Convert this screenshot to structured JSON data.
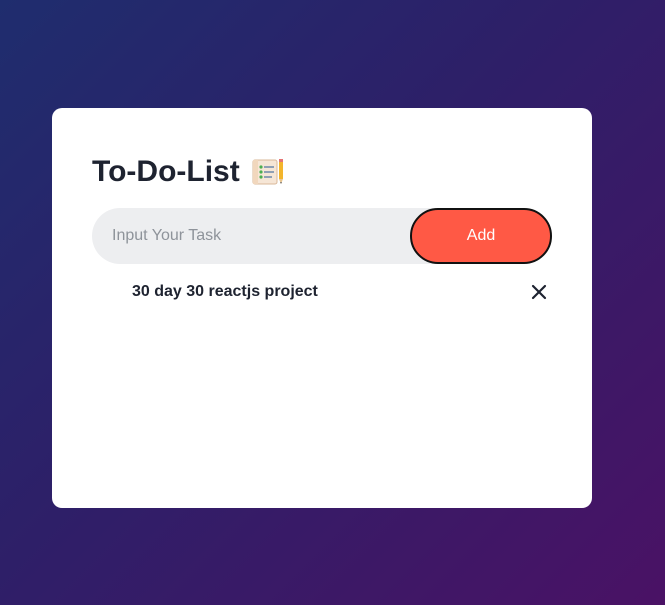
{
  "app": {
    "title": "To-Do-List",
    "title_icon": "notepad-checklist-icon"
  },
  "input": {
    "placeholder": "Input Your Task",
    "value": ""
  },
  "add_button": {
    "label": "Add"
  },
  "tasks": [
    {
      "text": "30 day 30 reactjs project",
      "delete_icon": "close-icon"
    }
  ],
  "colors": {
    "background_start": "#1f2d6e",
    "background_end": "#4a1265",
    "card": "#ffffff",
    "input_bg": "#edeef0",
    "accent": "#ff5945",
    "text": "#1e2330"
  }
}
